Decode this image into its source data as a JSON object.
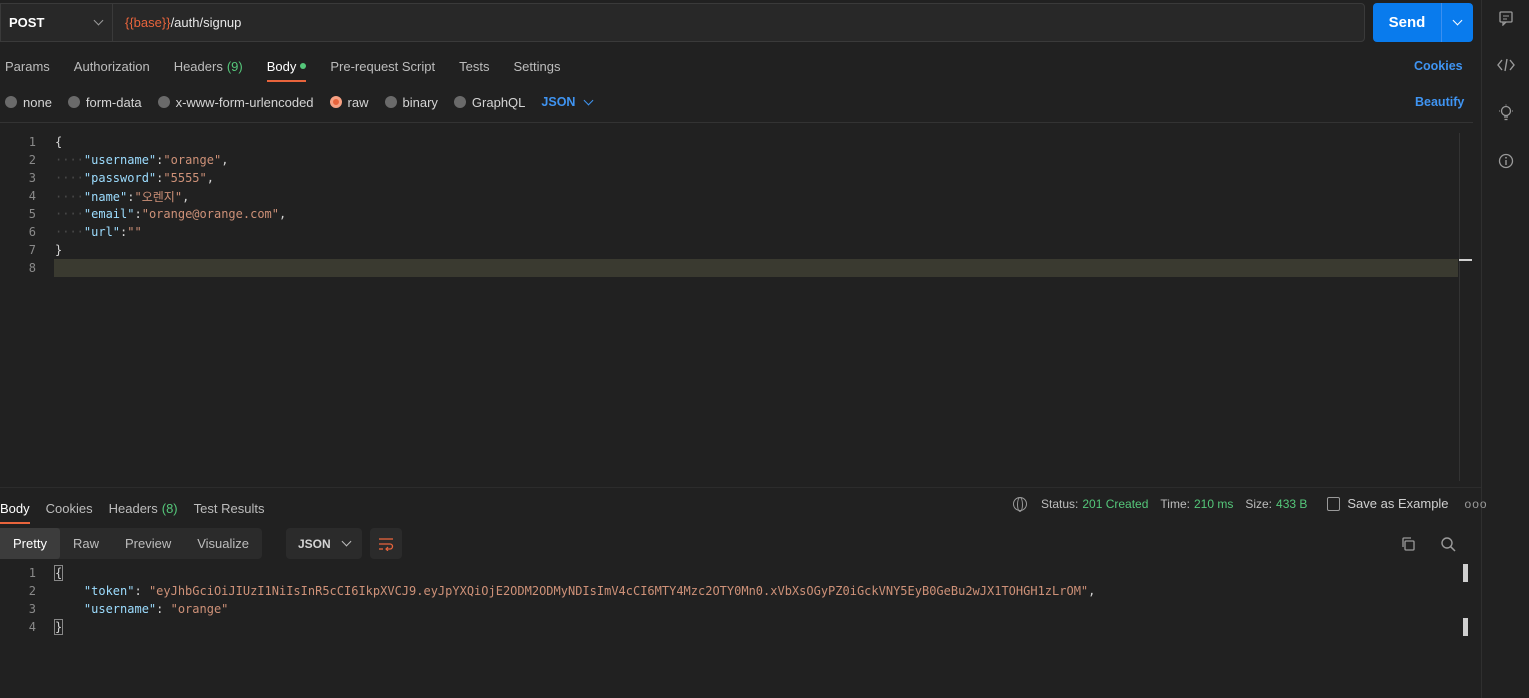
{
  "request": {
    "method": "POST",
    "url_var": "{{base}}",
    "url_path": "/auth/signup",
    "send_label": "Send"
  },
  "request_tabs": [
    {
      "label": "Params"
    },
    {
      "label": "Authorization"
    },
    {
      "label": "Headers",
      "count": "(9)"
    },
    {
      "label": "Body",
      "active": true
    },
    {
      "label": "Pre-request Script"
    },
    {
      "label": "Tests"
    },
    {
      "label": "Settings"
    }
  ],
  "cookies_link": "Cookies",
  "beautify_link": "Beautify",
  "body_types": [
    "none",
    "form-data",
    "x-www-form-urlencoded",
    "raw",
    "binary",
    "GraphQL"
  ],
  "selected_body_type": "raw",
  "body_language": "JSON",
  "request_body_lines": [
    {
      "n": "1",
      "text": "{"
    },
    {
      "n": "2",
      "key": "\"username\"",
      "val": "\"orange\"",
      "trail": ","
    },
    {
      "n": "3",
      "key": "\"password\"",
      "val": "\"5555\"",
      "trail": ","
    },
    {
      "n": "4",
      "key": "\"name\"",
      "val": "\"오렌지\"",
      "trail": ","
    },
    {
      "n": "5",
      "key": "\"email\"",
      "val": "\"orange@orange.com\"",
      "trail": ","
    },
    {
      "n": "6",
      "key": "\"url\"",
      "val": "\"\"",
      "trail": ""
    },
    {
      "n": "7",
      "text": "}"
    },
    {
      "n": "8",
      "text": ""
    }
  ],
  "response_tabs": [
    {
      "label": "Body",
      "active": true
    },
    {
      "label": "Cookies"
    },
    {
      "label": "Headers",
      "count": "(8)"
    },
    {
      "label": "Test Results"
    }
  ],
  "response_meta": {
    "status_label": "Status:",
    "status_value": "201 Created",
    "time_label": "Time:",
    "time_value": "210 ms",
    "size_label": "Size:",
    "size_value": "433 B",
    "save_example": "Save as Example",
    "more": "ooo"
  },
  "response_views": [
    "Pretty",
    "Raw",
    "Preview",
    "Visualize"
  ],
  "response_format": "JSON",
  "response_body_lines": [
    {
      "n": "1",
      "text": "{"
    },
    {
      "n": "2",
      "key": "\"token\"",
      "val": "\"eyJhbGciOiJIUzI1NiIsInR5cCI6IkpXVCJ9.eyJpYXQiOjE2ODM2ODMyNDIsImV4cCI6MTY4Mzc2OTY0Mn0.xVbXsOGyPZ0iGckVNY5EyB0GeBu2wJX1TOHGH1zLrOM\"",
      "trail": ","
    },
    {
      "n": "3",
      "key": "\"username\"",
      "val": "\"orange\"",
      "trail": ""
    },
    {
      "n": "4",
      "text": "}"
    }
  ],
  "colors": {
    "accent": "#e8643c",
    "link": "#3f94f2",
    "send": "#097bed",
    "success": "#55c77a"
  },
  "icons": [
    "comments-icon",
    "code-icon",
    "lightbulb-icon",
    "info-icon",
    "copy-icon",
    "search-icon",
    "globe-icon",
    "save-icon",
    "wrap-lines-icon"
  ]
}
